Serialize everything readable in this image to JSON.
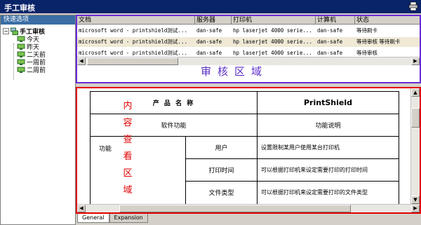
{
  "window": {
    "title": "手工审核"
  },
  "left": {
    "header": "快速选项",
    "tree": {
      "root": "手工审核",
      "children": [
        "今天",
        "昨天",
        "二天前",
        "一周前",
        "二周前"
      ]
    }
  },
  "audit": {
    "columns": [
      "文档",
      "服务器",
      "打印机",
      "计算机",
      "状态"
    ],
    "rows": [
      {
        "doc": "microsoft word - printshield测试...",
        "server": "dan-safe",
        "printer": "hp laserjet 4000 serie...",
        "computer": "dan-safe",
        "status": "等待刷卡"
      },
      {
        "doc": "microsoft word - printshield测试...",
        "server": "dan-safe",
        "printer": "hp laserjet 4000 serie...",
        "computer": "dan-safe",
        "status": "等待审核  等待刷卡"
      },
      {
        "doc": "microsoft word - printshield测试...",
        "server": "dan-safe",
        "printer": "hp laserjet 4000 serie...",
        "computer": "dan-safe",
        "status": "等待审核"
      }
    ],
    "overlay_label": "审核区域"
  },
  "content": {
    "overlay_label": [
      "内",
      "容",
      "查",
      "看",
      "区",
      "域"
    ],
    "table": {
      "h_name": "产 品 名 称",
      "h_product": "PrintShield",
      "r1_left": "软件功能",
      "r1_right": "功能说明",
      "r2_a": "功能",
      "r2_b": "用户",
      "r2_c": "设置限制某用户使用某台打印机",
      "r3_b": "打印时间",
      "r3_c": "可以根据打印机来设定需要打印的打印时间",
      "r4_b": "文件类型",
      "r4_c": "可以根据打印机来设定需要打印的文件类型"
    }
  },
  "tabs": [
    "General",
    "Expansion"
  ]
}
